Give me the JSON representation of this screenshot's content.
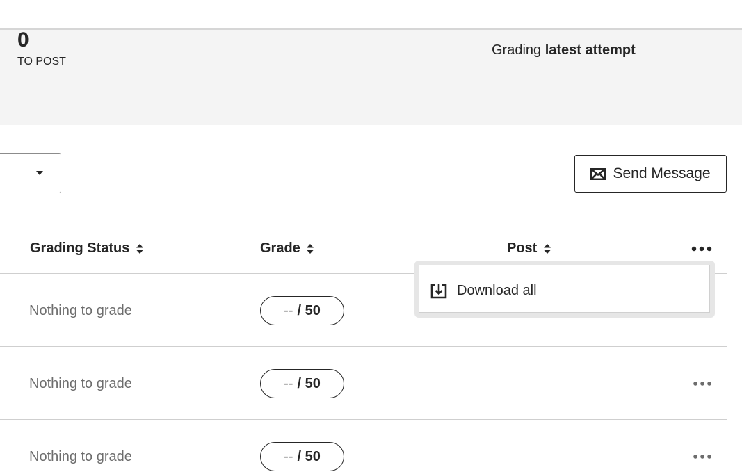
{
  "summary": {
    "to_post_count": "0",
    "to_post_label": "TO POST",
    "grading_prefix": "Grading",
    "grading_mode": "latest attempt"
  },
  "toolbar": {
    "send_message_label": "Send Message"
  },
  "table": {
    "headers": {
      "grading_status": "Grading Status",
      "grade": "Grade",
      "post": "Post"
    },
    "rows": [
      {
        "status": "Nothing to grade",
        "grade_value": "--",
        "grade_total": "/ 50"
      },
      {
        "status": "Nothing to grade",
        "grade_value": "--",
        "grade_total": "/ 50"
      },
      {
        "status": "Nothing to grade",
        "grade_value": "--",
        "grade_total": "/ 50"
      }
    ]
  },
  "menu": {
    "download_all_label": "Download all"
  },
  "icons": {
    "send": "envelope-icon",
    "sort": "sort-icon",
    "more": "more-icon",
    "download": "download-icon",
    "caret": "chevron-down-icon"
  },
  "colors": {
    "band": "#f4f4f4",
    "text": "#262626",
    "muted": "#6d6d6d",
    "divider": "#cfcfcf"
  }
}
